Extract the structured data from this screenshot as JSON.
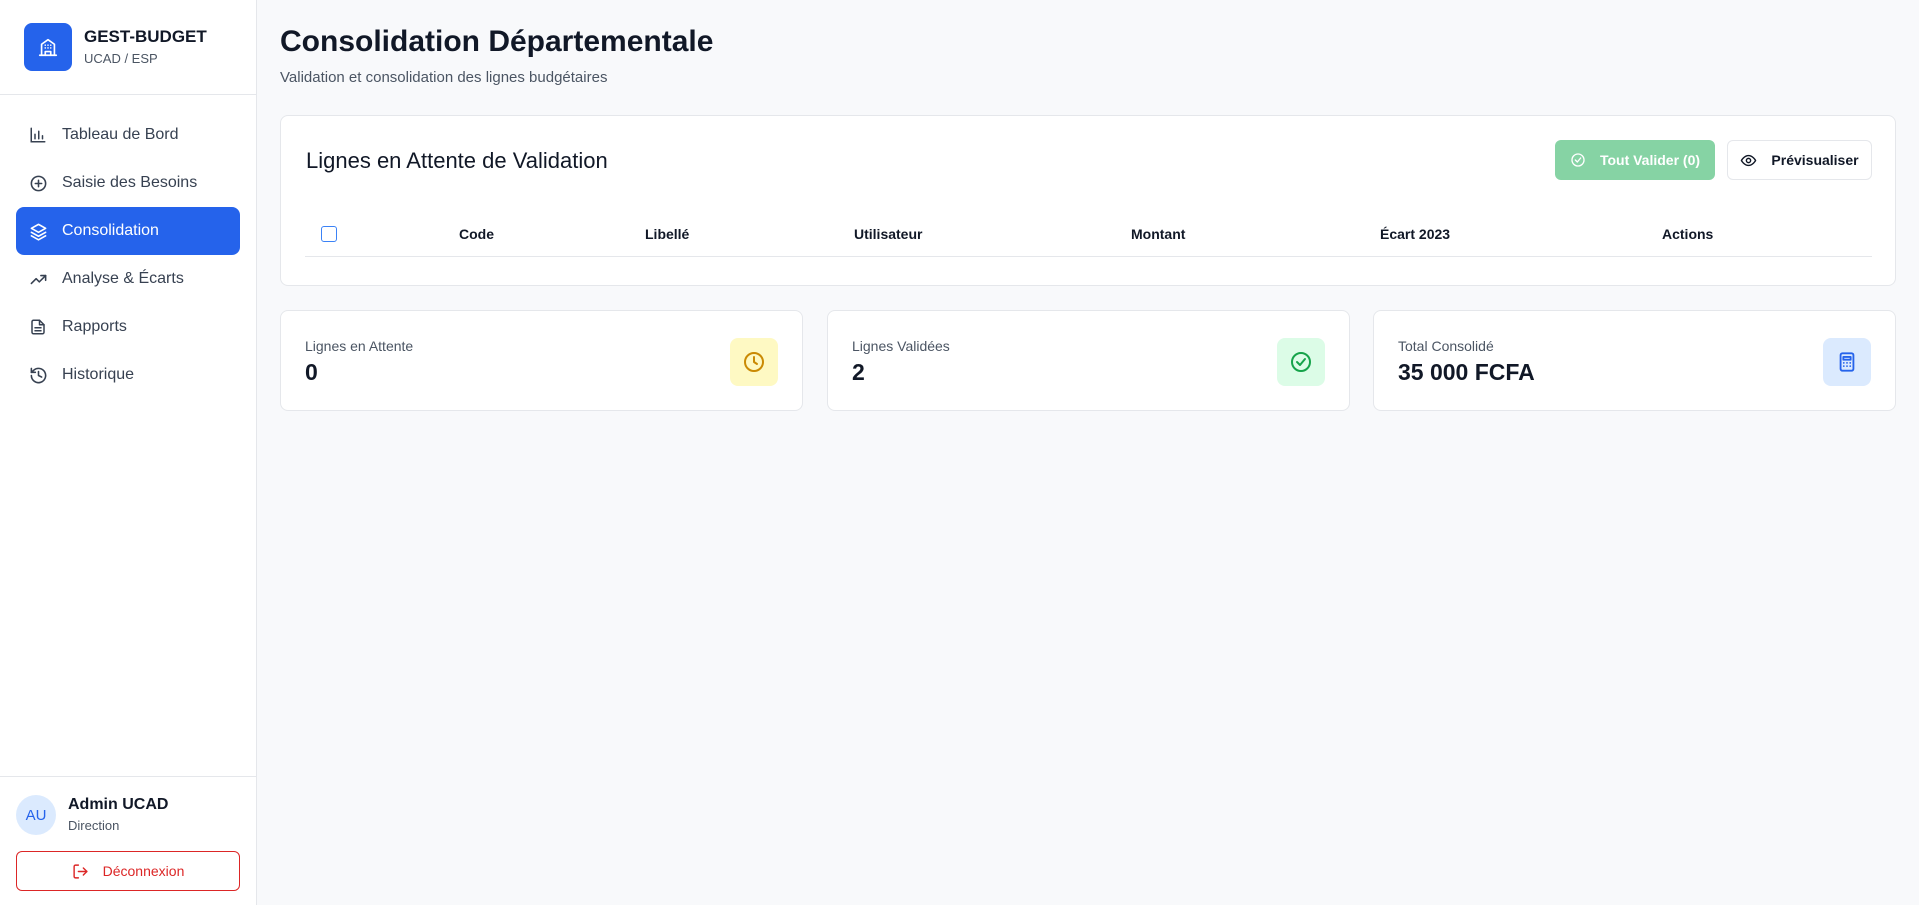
{
  "brand": {
    "title": "GEST-BUDGET",
    "subtitle": "UCAD / ESP",
    "logo_icon": "building-icon",
    "color": "#2563eb"
  },
  "nav": {
    "items": [
      {
        "label": "Tableau de Bord",
        "icon": "bar-chart-icon",
        "active": false
      },
      {
        "label": "Saisie des Besoins",
        "icon": "plus-circle-icon",
        "active": false
      },
      {
        "label": "Consolidation",
        "icon": "layers-icon",
        "active": true
      },
      {
        "label": "Analyse & Écarts",
        "icon": "trending-up-icon",
        "active": false
      },
      {
        "label": "Rapports",
        "icon": "file-text-icon",
        "active": false
      },
      {
        "label": "Historique",
        "icon": "history-icon",
        "active": false
      }
    ]
  },
  "user": {
    "initials": "AU",
    "name": "Admin UCAD",
    "role": "Direction"
  },
  "logout": {
    "label": "Déconnexion",
    "icon": "log-out-icon",
    "color": "#dc2626"
  },
  "page": {
    "title": "Consolidation Départementale",
    "subtitle": "Validation et consolidation des lignes budgétaires"
  },
  "panel": {
    "title": "Lignes en Attente de Validation",
    "validate_all_label": "Tout Valider (0)",
    "preview_label": "Prévisualiser",
    "columns": [
      "Code",
      "Libellé",
      "Utilisateur",
      "Montant",
      "Écart 2023",
      "Actions"
    ],
    "rows": []
  },
  "stats": [
    {
      "label": "Lignes en Attente",
      "value": "0",
      "icon": "clock-icon",
      "bg": "#fef9c3",
      "color": "#ca8a04"
    },
    {
      "label": "Lignes Validées",
      "value": "2",
      "icon": "check-circle-icon",
      "bg": "#dcfce7",
      "color": "#16a34a"
    },
    {
      "label": "Total Consolidé",
      "value": "35 000 FCFA",
      "icon": "calculator-icon",
      "bg": "#dbeafe",
      "color": "#2563eb"
    }
  ]
}
